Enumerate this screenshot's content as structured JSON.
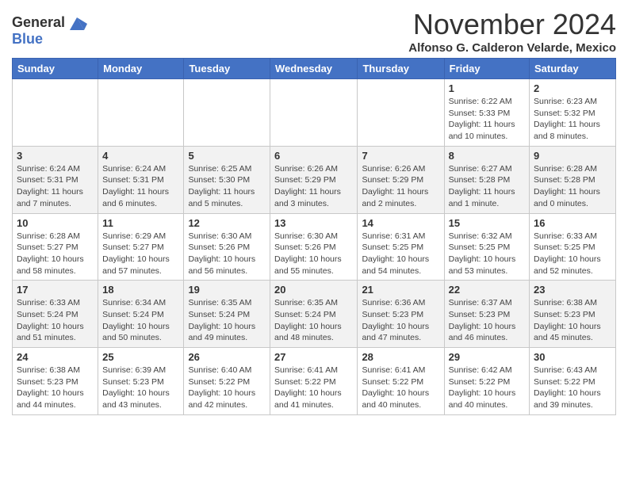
{
  "header": {
    "logo_line1": "General",
    "logo_line2": "Blue",
    "month_title": "November 2024",
    "subtitle": "Alfonso G. Calderon Velarde, Mexico"
  },
  "days_of_week": [
    "Sunday",
    "Monday",
    "Tuesday",
    "Wednesday",
    "Thursday",
    "Friday",
    "Saturday"
  ],
  "weeks": [
    [
      {
        "day": "",
        "info": ""
      },
      {
        "day": "",
        "info": ""
      },
      {
        "day": "",
        "info": ""
      },
      {
        "day": "",
        "info": ""
      },
      {
        "day": "",
        "info": ""
      },
      {
        "day": "1",
        "info": "Sunrise: 6:22 AM\nSunset: 5:33 PM\nDaylight: 11 hours and 10 minutes."
      },
      {
        "day": "2",
        "info": "Sunrise: 6:23 AM\nSunset: 5:32 PM\nDaylight: 11 hours and 8 minutes."
      }
    ],
    [
      {
        "day": "3",
        "info": "Sunrise: 6:24 AM\nSunset: 5:31 PM\nDaylight: 11 hours and 7 minutes."
      },
      {
        "day": "4",
        "info": "Sunrise: 6:24 AM\nSunset: 5:31 PM\nDaylight: 11 hours and 6 minutes."
      },
      {
        "day": "5",
        "info": "Sunrise: 6:25 AM\nSunset: 5:30 PM\nDaylight: 11 hours and 5 minutes."
      },
      {
        "day": "6",
        "info": "Sunrise: 6:26 AM\nSunset: 5:29 PM\nDaylight: 11 hours and 3 minutes."
      },
      {
        "day": "7",
        "info": "Sunrise: 6:26 AM\nSunset: 5:29 PM\nDaylight: 11 hours and 2 minutes."
      },
      {
        "day": "8",
        "info": "Sunrise: 6:27 AM\nSunset: 5:28 PM\nDaylight: 11 hours and 1 minute."
      },
      {
        "day": "9",
        "info": "Sunrise: 6:28 AM\nSunset: 5:28 PM\nDaylight: 11 hours and 0 minutes."
      }
    ],
    [
      {
        "day": "10",
        "info": "Sunrise: 6:28 AM\nSunset: 5:27 PM\nDaylight: 10 hours and 58 minutes."
      },
      {
        "day": "11",
        "info": "Sunrise: 6:29 AM\nSunset: 5:27 PM\nDaylight: 10 hours and 57 minutes."
      },
      {
        "day": "12",
        "info": "Sunrise: 6:30 AM\nSunset: 5:26 PM\nDaylight: 10 hours and 56 minutes."
      },
      {
        "day": "13",
        "info": "Sunrise: 6:30 AM\nSunset: 5:26 PM\nDaylight: 10 hours and 55 minutes."
      },
      {
        "day": "14",
        "info": "Sunrise: 6:31 AM\nSunset: 5:25 PM\nDaylight: 10 hours and 54 minutes."
      },
      {
        "day": "15",
        "info": "Sunrise: 6:32 AM\nSunset: 5:25 PM\nDaylight: 10 hours and 53 minutes."
      },
      {
        "day": "16",
        "info": "Sunrise: 6:33 AM\nSunset: 5:25 PM\nDaylight: 10 hours and 52 minutes."
      }
    ],
    [
      {
        "day": "17",
        "info": "Sunrise: 6:33 AM\nSunset: 5:24 PM\nDaylight: 10 hours and 51 minutes."
      },
      {
        "day": "18",
        "info": "Sunrise: 6:34 AM\nSunset: 5:24 PM\nDaylight: 10 hours and 50 minutes."
      },
      {
        "day": "19",
        "info": "Sunrise: 6:35 AM\nSunset: 5:24 PM\nDaylight: 10 hours and 49 minutes."
      },
      {
        "day": "20",
        "info": "Sunrise: 6:35 AM\nSunset: 5:24 PM\nDaylight: 10 hours and 48 minutes."
      },
      {
        "day": "21",
        "info": "Sunrise: 6:36 AM\nSunset: 5:23 PM\nDaylight: 10 hours and 47 minutes."
      },
      {
        "day": "22",
        "info": "Sunrise: 6:37 AM\nSunset: 5:23 PM\nDaylight: 10 hours and 46 minutes."
      },
      {
        "day": "23",
        "info": "Sunrise: 6:38 AM\nSunset: 5:23 PM\nDaylight: 10 hours and 45 minutes."
      }
    ],
    [
      {
        "day": "24",
        "info": "Sunrise: 6:38 AM\nSunset: 5:23 PM\nDaylight: 10 hours and 44 minutes."
      },
      {
        "day": "25",
        "info": "Sunrise: 6:39 AM\nSunset: 5:23 PM\nDaylight: 10 hours and 43 minutes."
      },
      {
        "day": "26",
        "info": "Sunrise: 6:40 AM\nSunset: 5:22 PM\nDaylight: 10 hours and 42 minutes."
      },
      {
        "day": "27",
        "info": "Sunrise: 6:41 AM\nSunset: 5:22 PM\nDaylight: 10 hours and 41 minutes."
      },
      {
        "day": "28",
        "info": "Sunrise: 6:41 AM\nSunset: 5:22 PM\nDaylight: 10 hours and 40 minutes."
      },
      {
        "day": "29",
        "info": "Sunrise: 6:42 AM\nSunset: 5:22 PM\nDaylight: 10 hours and 40 minutes."
      },
      {
        "day": "30",
        "info": "Sunrise: 6:43 AM\nSunset: 5:22 PM\nDaylight: 10 hours and 39 minutes."
      }
    ]
  ]
}
